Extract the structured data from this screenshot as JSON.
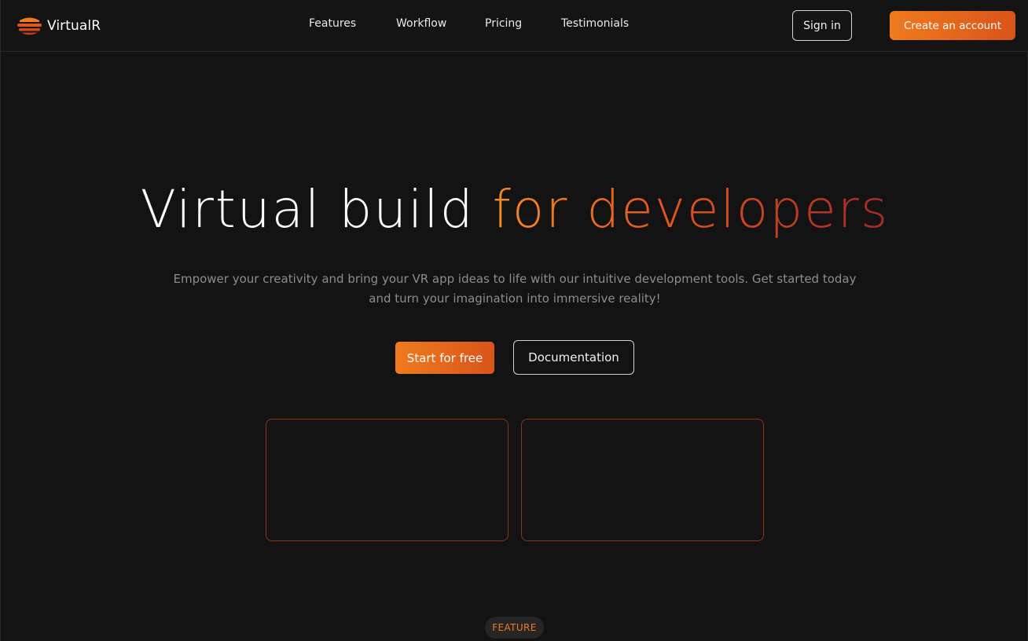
{
  "brand": {
    "name": "VirtualR",
    "logo_icon": "stacked-bars-logo-icon",
    "logo_colors": [
      "#f07a1e",
      "#e0551c",
      "#c43a1a"
    ]
  },
  "nav": {
    "links": [
      {
        "label": "Features"
      },
      {
        "label": "Workflow"
      },
      {
        "label": "Pricing"
      },
      {
        "label": "Testimonials"
      }
    ],
    "sign_in_label": "Sign in",
    "create_account_label": "Create an account"
  },
  "hero": {
    "title_plain": "Virtual build ",
    "title_accent": "for developers",
    "subtitle": "Empower your creativity and bring your VR app ideas to life with our intuitive development tools. Get started today and turn your imagination into immersive reality!",
    "primary_cta": "Start for free",
    "secondary_cta": "Documentation",
    "media_frames": 2
  },
  "feature_badge": "FEATURE",
  "colors": {
    "background": "#131313",
    "accent_start": "#f07a1e",
    "accent_end": "#d9541a",
    "title_gradient_end": "#a3282a",
    "frame_border": "#8a3514",
    "muted_text": "#8d8d8d"
  }
}
